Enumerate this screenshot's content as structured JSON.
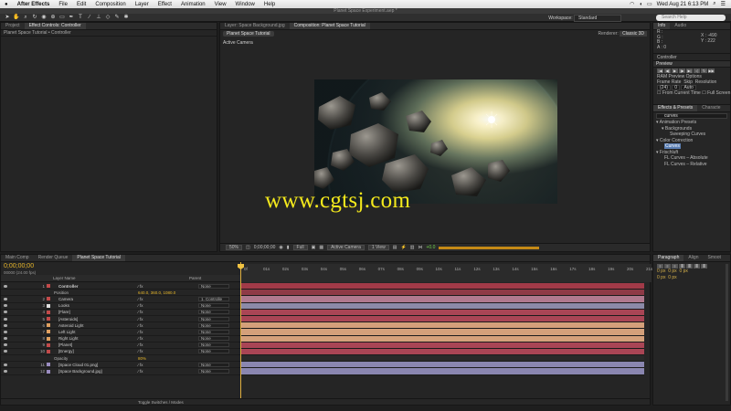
{
  "menubar": {
    "apple": "",
    "app_name": "After Effects",
    "items": [
      "File",
      "Edit",
      "Composition",
      "Layer",
      "Effect",
      "Animation",
      "View",
      "Window",
      "Help"
    ],
    "status": "Wed Aug 21  6:13 PM"
  },
  "window": {
    "title": "Planet Space Experiment.aep *"
  },
  "toolbar": {
    "workspace_label": "Workspace:",
    "workspace_value": "Standard",
    "search_placeholder": "Search Help"
  },
  "project_panel": {
    "tabs": [
      "Project",
      "Effect Controls: Controller"
    ],
    "active_tab": 1,
    "subtitle": "Planet Space Tutorial • Controller"
  },
  "comp_panel": {
    "tabs": [
      "Layer: Space Background.jpg",
      "Composition: Planet Space Tutorial"
    ],
    "active_tab": 1,
    "comp_button": "Planet Space Tutorial",
    "renderer_label": "Renderer:",
    "renderer_value": "Classic 3D",
    "view_label": "Active Camera",
    "bottom": {
      "zoom": "50%",
      "timecode": "0;00;00;00",
      "resolution": "Full",
      "camera": "Active Camera",
      "views": "1 View",
      "exposure": "+0.0"
    }
  },
  "watermark": "www.cgtsj.com",
  "right": {
    "info": {
      "tabs": [
        "Info",
        "Audio"
      ],
      "lines": [
        "R :",
        "G :",
        "B :",
        "A : 0"
      ],
      "coords": [
        "X : -490",
        "Y : 222"
      ]
    },
    "controller_label": "Controller",
    "preview": {
      "title": "Preview",
      "ram_options": "RAM Preview Options",
      "frame_rate_label": "Frame Rate",
      "skip_label": "Skip",
      "resolution_label": "Resolution",
      "frame_rate_value": "(24)",
      "skip_value": "0",
      "resolution_value": "Auto",
      "from_current": "From Current Time",
      "full_screen": "Full Screen"
    },
    "effects": {
      "tabs": [
        "Effects & Presets",
        "Characte"
      ],
      "search_value": "curves",
      "tree": [
        "▾ Animation Presets",
        "▾ Backgrounds",
        "Sweeping Curves",
        "▾ Color Correction",
        "Curves",
        "▾ Frischluft",
        "FL Curves – Absolute",
        "FL Curves – Relative"
      ],
      "highlight_index": 4
    },
    "paragraph": {
      "tabs": [
        "Paragraph",
        "Align",
        "Smoot"
      ],
      "fields": [
        "0 px",
        "0 px",
        "0 px",
        "0 px",
        "0 px"
      ]
    }
  },
  "timeline": {
    "tabs": [
      "Render Queue",
      "Render Queue",
      "Planet Space Tutorial"
    ],
    "tab_names": [
      "Main Comp",
      "Render Queue",
      "Planet Space Tutorial"
    ],
    "active_tab": 2,
    "timecode": "0;00;00;00",
    "frames": "00000 (24.00 fps)",
    "col_layer_name": "Layer Name",
    "col_parent": "Parent",
    "ruler": [
      "0f",
      "01s",
      "02s",
      "03s",
      "04s",
      "05s",
      "06s",
      "07s",
      "08s",
      "09s",
      "10s",
      "11s",
      "12s",
      "13s",
      "14s",
      "15s",
      "16s",
      "17s",
      "18s",
      "19s",
      "20s",
      "21s"
    ],
    "layers": [
      {
        "num": "1",
        "name": "Controller",
        "color": "#c24a4a",
        "parent": "None",
        "bar": "#a23a48",
        "bold": true
      },
      {
        "num": "",
        "name": "Position",
        "color": "",
        "parent": "",
        "bar": "#8e3a46",
        "value": "640.0, 360.0, 1080.0",
        "sub": true
      },
      {
        "num": "2",
        "name": "Camera",
        "color": "#c24a4a",
        "parent": "1. Controlle",
        "bar": "#b0798e"
      },
      {
        "num": "3",
        "name": "Looks",
        "color": "#e0e0e0",
        "parent": "None",
        "bar": "#8c8aa8"
      },
      {
        "num": "4",
        "name": "[Flare]",
        "color": "#c24a4a",
        "parent": "None",
        "bar": "#a94555"
      },
      {
        "num": "5",
        "name": "[Asteroids]",
        "color": "#c24a4a",
        "parent": "None",
        "bar": "#a94555"
      },
      {
        "num": "6",
        "name": "Asteroid Light",
        "color": "#e0a060",
        "parent": "None",
        "bar": "#d4a07a"
      },
      {
        "num": "7",
        "name": "Left Light",
        "color": "#e0a060",
        "parent": "None",
        "bar": "#d4a07a"
      },
      {
        "num": "8",
        "name": "Right Light",
        "color": "#e0a060",
        "parent": "None",
        "bar": "#d4a07a"
      },
      {
        "num": "9",
        "name": "[Planet]",
        "color": "#c24a4a",
        "parent": "None",
        "bar": "#a94555"
      },
      {
        "num": "10",
        "name": "[Energy]",
        "color": "#c24a4a",
        "parent": "None",
        "bar": "#a94555"
      },
      {
        "num": "",
        "name": "Opacity",
        "color": "",
        "parent": "",
        "bar": "#2a2a2a",
        "value": "80%",
        "sub": true
      },
      {
        "num": "11",
        "name": "[Space Cloud 01.png]",
        "color": "#9a8cc0",
        "parent": "None",
        "bar": "#8a86b0"
      },
      {
        "num": "12",
        "name": "[Space Background.jpg]",
        "color": "#9a8cc0",
        "parent": "None",
        "bar": "#8a86b0"
      }
    ],
    "footer": "Toggle Switches / Modes"
  }
}
